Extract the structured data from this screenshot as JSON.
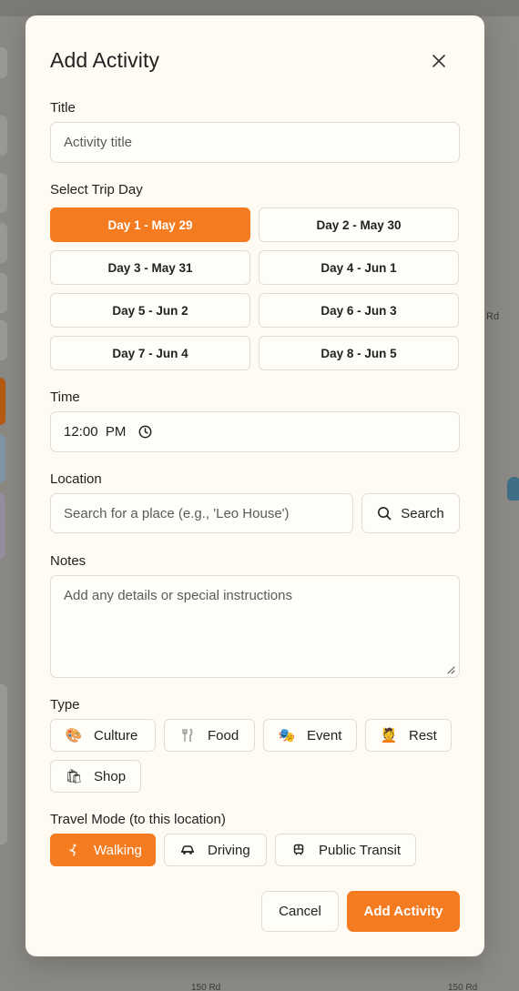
{
  "background": {
    "road_label_right": "Rd",
    "road_label_bottom_1": "150 Rd",
    "road_label_bottom_2": "150 Rd"
  },
  "modal": {
    "title": "Add Activity",
    "close_icon": "close-icon",
    "title_field": {
      "label": "Title",
      "placeholder": "Activity title",
      "value": ""
    },
    "trip_day": {
      "label": "Select Trip Day",
      "days": [
        {
          "label": "Day 1 - May 29",
          "selected": true
        },
        {
          "label": "Day 2 - May 30",
          "selected": false
        },
        {
          "label": "Day 3 - May 31",
          "selected": false
        },
        {
          "label": "Day 4 - Jun 1",
          "selected": false
        },
        {
          "label": "Day 5 - Jun 2",
          "selected": false
        },
        {
          "label": "Day 6 - Jun 3",
          "selected": false
        },
        {
          "label": "Day 7 - Jun 4",
          "selected": false
        },
        {
          "label": "Day 8 - Jun 5",
          "selected": false
        }
      ]
    },
    "time": {
      "label": "Time",
      "value": "12:00  PM",
      "icon": "clock-icon"
    },
    "location": {
      "label": "Location",
      "placeholder": "Search for a place (e.g., 'Leo House')",
      "search_button": "Search",
      "search_icon": "search-icon"
    },
    "notes": {
      "label": "Notes",
      "placeholder": "Add any details or special instructions"
    },
    "type": {
      "label": "Type",
      "options": [
        {
          "label": "Culture",
          "icon": "palette-icon",
          "glyph": "🎨"
        },
        {
          "label": "Food",
          "icon": "fork-knife-icon",
          "glyph": "🍴"
        },
        {
          "label": "Event",
          "icon": "theater-masks-icon",
          "glyph": "🎭"
        },
        {
          "label": "Rest",
          "icon": "person-resting-icon",
          "glyph": "💆"
        },
        {
          "label": "Shop",
          "icon": "shopping-bag-icon",
          "glyph": "🛍"
        }
      ]
    },
    "travel_mode": {
      "label": "Travel Mode (to this location)",
      "options": [
        {
          "label": "Walking",
          "icon": "walking-icon",
          "selected": true
        },
        {
          "label": "Driving",
          "icon": "car-icon",
          "selected": false
        },
        {
          "label": "Public Transit",
          "icon": "train-icon",
          "selected": false
        }
      ]
    },
    "footer": {
      "cancel": "Cancel",
      "submit": "Add Activity"
    }
  },
  "colors": {
    "accent": "#f47b20",
    "modal_bg": "#fffbf3",
    "border": "#e1ddd4"
  }
}
